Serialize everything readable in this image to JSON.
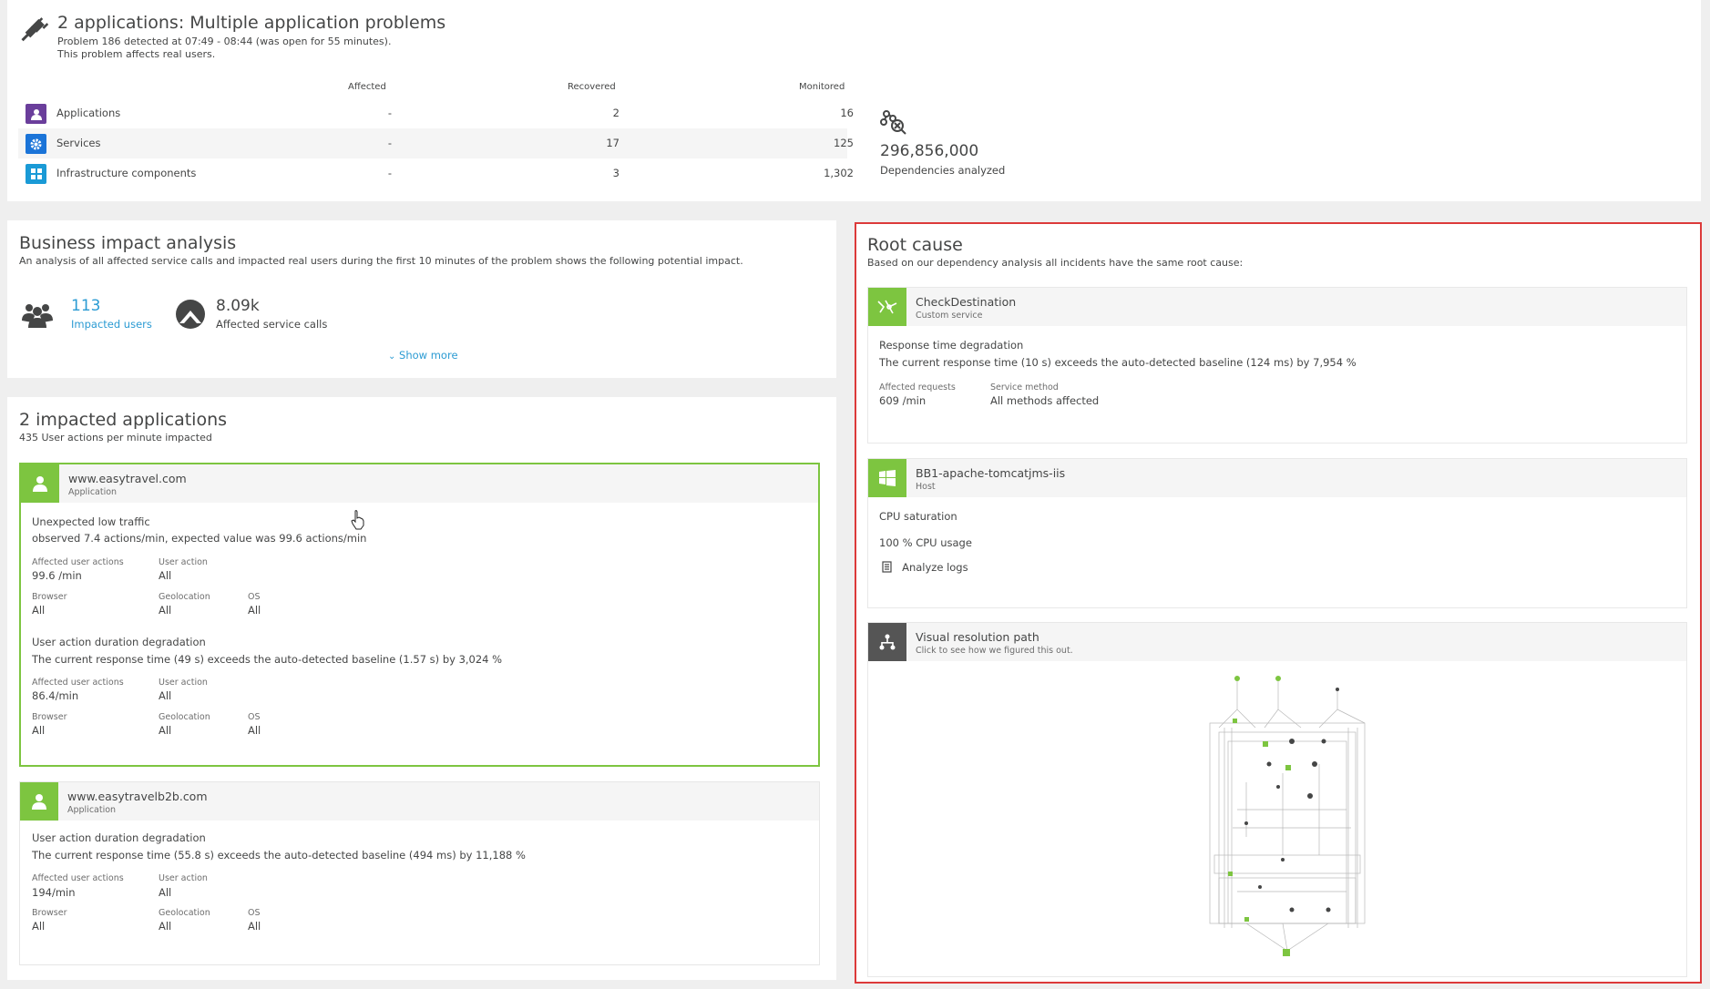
{
  "problem": {
    "title": "2 applications: Multiple application problems",
    "detected": "Problem 186 detected at 07:49 - 08:44 (was open for 55 minutes).",
    "affects": "This problem affects real users."
  },
  "stats": {
    "headers": {
      "affected": "Affected",
      "recovered": "Recovered",
      "monitored": "Monitored"
    },
    "rows": [
      {
        "label": "Applications",
        "affected": "-",
        "recovered": "2",
        "monitored": "16",
        "icon": "user-icon",
        "color": "#6a3e9b"
      },
      {
        "label": "Services",
        "affected": "-",
        "recovered": "17",
        "monitored": "125",
        "icon": "gear-icon",
        "color": "#1b74d8"
      },
      {
        "label": "Infrastructure components",
        "affected": "-",
        "recovered": "3",
        "monitored": "1,302",
        "icon": "host-icon",
        "color": "#1a9ad6"
      }
    ]
  },
  "dependencies": {
    "value": "296,856,000",
    "label": "Dependencies analyzed"
  },
  "business": {
    "title": "Business impact analysis",
    "desc": "An analysis of all affected service calls and impacted real users during the first 10 minutes of the problem shows the following potential impact.",
    "users_value": "113",
    "users_label": "Impacted users",
    "calls_value": "8.09k",
    "calls_label": "Affected service calls",
    "show_more": "Show more"
  },
  "apps": {
    "title": "2 impacted applications",
    "desc": "435 User actions per minute impacted",
    "cards": [
      {
        "name": "www.easytravel.com",
        "type": "Application",
        "issue1_title": "Unexpected low traffic",
        "issue1_desc": "observed 7.4 actions/min, expected value was 99.6 actions/min",
        "issue1_actions": "99.6 /min",
        "issue2_title": "User action duration degradation",
        "issue2_desc": "The current response time (49 s) exceeds the auto-detected baseline (1.57 s) by 3,024 %",
        "issue2_actions": "86.4/min"
      },
      {
        "name": "www.easytravelb2b.com",
        "type": "Application",
        "issue1_title": "User action duration degradation",
        "issue1_desc": "The current response time (55.8 s) exceeds the auto-detected baseline (494 ms) by 11,188 %",
        "issue1_actions": "194/min"
      }
    ],
    "labels": {
      "affected_user_actions": "Affected user actions",
      "user_action": "User action",
      "browser": "Browser",
      "geolocation": "Geolocation",
      "os": "OS",
      "all": "All"
    }
  },
  "root": {
    "title": "Root cause",
    "desc": "Based on our dependency analysis all incidents have the same root cause:",
    "service": {
      "name": "CheckDestination",
      "type": "Custom service",
      "issue": "Response time degradation",
      "issue_desc": "The current response time (10 s) exceeds the auto-detected baseline (124 ms) by 7,954 %",
      "req_label": "Affected requests",
      "req_value": "609 /min",
      "method_label": "Service method",
      "method_value": "All methods affected"
    },
    "host": {
      "name": "BB1-apache-tomcatjms-iis",
      "type": "Host",
      "issue": "CPU saturation",
      "value": "100 % CPU usage",
      "link": "Analyze logs"
    },
    "path": {
      "name": "Visual resolution path",
      "type": "Click to see how we figured this out."
    }
  },
  "colors": {
    "green": "#7dc540",
    "link": "#2b9bd3",
    "highlight": "#dc3a3a"
  }
}
